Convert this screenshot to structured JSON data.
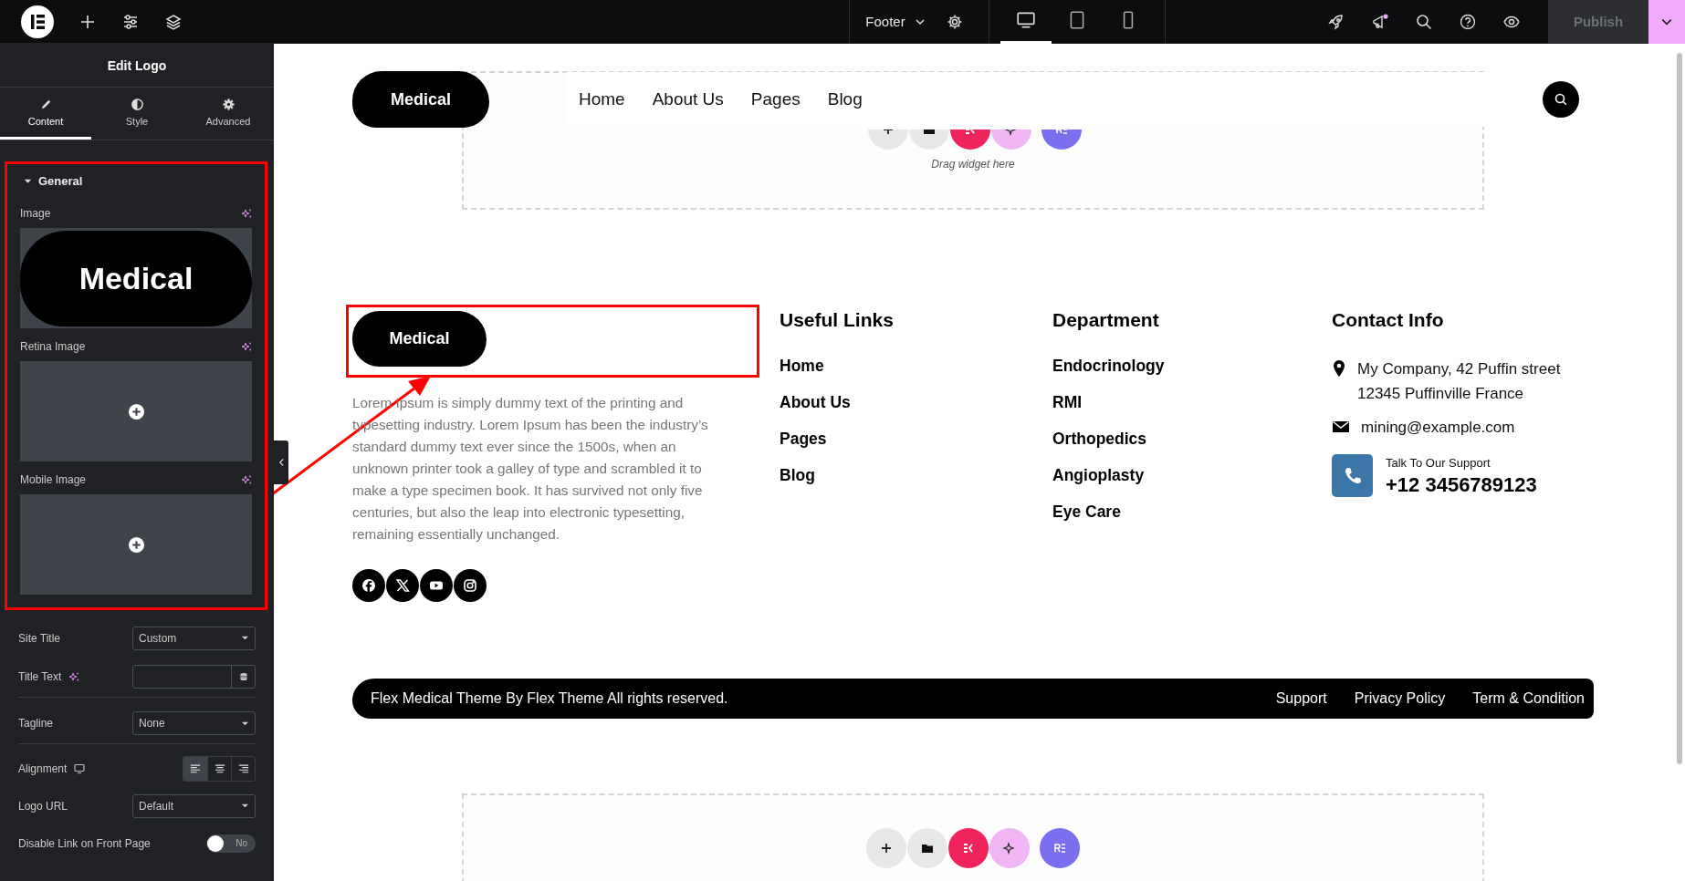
{
  "top_bar": {
    "document": "Footer",
    "devices": [
      {
        "kind": "desktop",
        "selected": true
      },
      {
        "kind": "tablet",
        "selected": false
      },
      {
        "kind": "mobile",
        "selected": false
      }
    ],
    "publish": {
      "label": "Publish",
      "disabled": true
    }
  },
  "panel": {
    "title": "Edit Logo",
    "tabs": [
      {
        "kind": "content",
        "label": "Content",
        "selected": true
      },
      {
        "kind": "style",
        "label": "Style",
        "selected": false
      },
      {
        "kind": "advanced",
        "label": "Advanced",
        "selected": false
      }
    ],
    "section": {
      "title": "General",
      "expanded": true
    },
    "images": [
      {
        "label": "Image",
        "kind": "filled",
        "preview": "Medical"
      },
      {
        "label": "Retina Image",
        "kind": "empty"
      },
      {
        "label": "Mobile Image",
        "kind": "empty"
      }
    ],
    "controls": [
      {
        "kind": "select",
        "label": "Site Title",
        "value": "Custom"
      },
      {
        "kind": "text",
        "label": "Title Text"
      },
      {
        "kind": "select",
        "label": "Tagline",
        "value": "None"
      },
      {
        "kind": "align",
        "label": "Alignment",
        "options": [
          {
            "kind": "left",
            "selected": true
          },
          {
            "kind": "center",
            "selected": false
          },
          {
            "kind": "right",
            "selected": false
          }
        ]
      },
      {
        "kind": "select",
        "label": "Logo URL",
        "value": "Default"
      },
      {
        "kind": "toggle",
        "label": "Disable Link on Front Page",
        "on": false,
        "value": "No"
      }
    ]
  },
  "header": {
    "logo": "Medical",
    "nav": [
      "Home",
      "About Us",
      "Pages",
      "Blog"
    ],
    "drop_hint": "Drag widget here"
  },
  "footer": {
    "logo": "Medical",
    "about": "Lorem Ipsum is simply dummy text of the printing and typesetting industry. Lorem Ipsum has been the industry’s standard dummy text ever since the 1500s, when an unknown printer took a galley of type and scrambled it to make a type specimen book. It has survived not only five centuries, but also the leap into electronic typesetting, remaining essentially unchanged.",
    "socials": [
      {
        "kind": "facebook"
      },
      {
        "kind": "x"
      },
      {
        "kind": "youtube"
      },
      {
        "kind": "instagram"
      }
    ],
    "columns": [
      {
        "heading": "Useful Links",
        "links": [
          "Home",
          "About Us",
          "Pages",
          "Blog"
        ]
      },
      {
        "heading": "Department",
        "links": [
          "Endocrinology",
          "RMI",
          "Orthopedics",
          "Angioplasty",
          "Eye Care"
        ]
      }
    ],
    "contact": {
      "heading": "Contact Info",
      "address": [
        "My Company, 42 Puffin street",
        "12345 Puffinville France"
      ],
      "email": "mining@example.com",
      "support_label": "Talk To Our Support",
      "phone": "+12 3456789123"
    },
    "bottom": {
      "copyright": "Flex Medical Theme By Flex Theme All rights reserved.",
      "links": [
        "Support",
        "Privacy Policy",
        "Term & Condition"
      ]
    }
  }
}
